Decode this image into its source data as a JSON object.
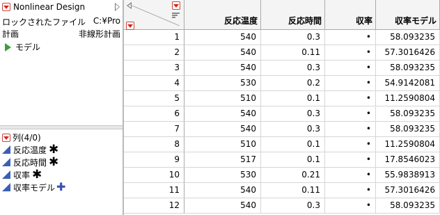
{
  "table_panel": {
    "name": "Nonlinear Design",
    "locked_file_label": "ロックされたファイル",
    "locked_file_path": "C:¥Pro",
    "design_label": "計画",
    "design_value": "非線形計画",
    "script_name": "モデル"
  },
  "columns_panel": {
    "title": "列(4/0)",
    "columns": [
      {
        "name": "反応温度",
        "marker": "✱"
      },
      {
        "name": "反応時間",
        "marker": "✱"
      },
      {
        "name": "収率",
        "marker": "✱"
      },
      {
        "name": "収率モデル",
        "marker": "✚"
      }
    ]
  },
  "grid": {
    "headers": [
      "反応温度",
      "反応時間",
      "収率",
      "収率モデル"
    ],
    "rows": [
      {
        "n": "1",
        "temp": "540",
        "time": "0.3",
        "yield": "•",
        "model": "58.093235"
      },
      {
        "n": "2",
        "temp": "540",
        "time": "0.11",
        "yield": "•",
        "model": "57.3016426"
      },
      {
        "n": "3",
        "temp": "540",
        "time": "0.3",
        "yield": "•",
        "model": "58.093235"
      },
      {
        "n": "4",
        "temp": "530",
        "time": "0.2",
        "yield": "•",
        "model": "54.9142081"
      },
      {
        "n": "5",
        "temp": "510",
        "time": "0.1",
        "yield": "•",
        "model": "11.2590804"
      },
      {
        "n": "6",
        "temp": "540",
        "time": "0.3",
        "yield": "•",
        "model": "58.093235"
      },
      {
        "n": "7",
        "temp": "540",
        "time": "0.3",
        "yield": "•",
        "model": "58.093235"
      },
      {
        "n": "8",
        "temp": "510",
        "time": "0.1",
        "yield": "•",
        "model": "11.2590804"
      },
      {
        "n": "9",
        "temp": "517",
        "time": "0.1",
        "yield": "•",
        "model": "17.8546023"
      },
      {
        "n": "10",
        "temp": "530",
        "time": "0.21",
        "yield": "•",
        "model": "55.9838913"
      },
      {
        "n": "11",
        "temp": "540",
        "time": "0.11",
        "yield": "•",
        "model": "57.3016426"
      },
      {
        "n": "12",
        "temp": "540",
        "time": "0.3",
        "yield": "•",
        "model": "58.093235"
      }
    ]
  }
}
